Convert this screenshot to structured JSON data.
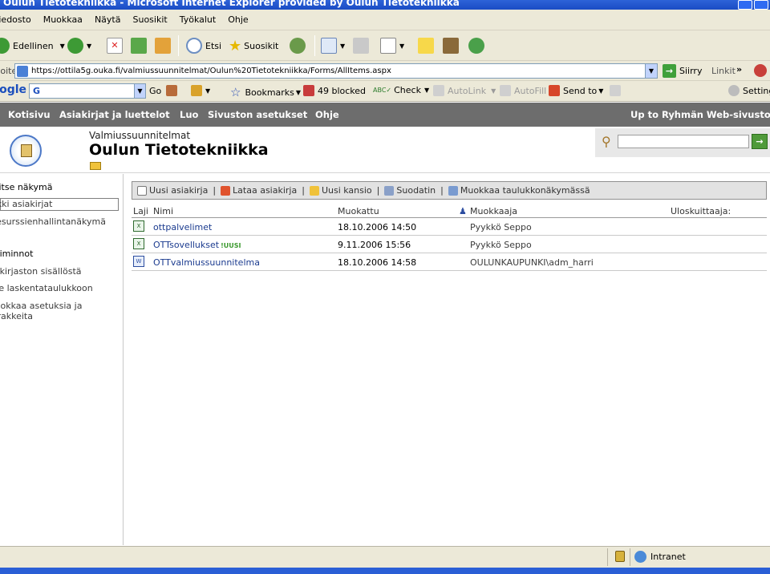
{
  "window": {
    "title": "Oulun Tietotekniikka - Microsoft Internet Explorer provided by Oulun Tietotekniikka"
  },
  "menubar": [
    "Tiedosto",
    "Muokkaa",
    "Näytä",
    "Suosikit",
    "Työkalut",
    "Ohje"
  ],
  "toolbar": {
    "back": "Edellinen",
    "search": "Etsi",
    "favorites": "Suosikit"
  },
  "addressbar": {
    "label": "Osoite",
    "url": "https://ottila5g.ouka.fi/valmiussuunnitelmat/Oulun%20Tietotekniikka/Forms/AllItems.aspx",
    "go": "Siirry",
    "links": "Linkit"
  },
  "google_toolbar": {
    "logo": "Google",
    "search_value": "G",
    "go": "Go",
    "bookmarks": "Bookmarks",
    "blocked": "49 blocked",
    "check": "Check",
    "autolink": "AutoLink",
    "autofill": "AutoFill",
    "sendto": "Send to",
    "settings": "Settings"
  },
  "topnav": {
    "items": [
      "Kotisivu",
      "Asiakirjat ja luettelot",
      "Luo",
      "Sivuston asetukset",
      "Ohje"
    ],
    "right_link": "Up to Ryhmän Web-sivusto"
  },
  "header": {
    "subtitle": "Valmiussuunnitelmat",
    "title": "Oulun Tietotekniikka"
  },
  "leftnav": {
    "select_view_heading": "Valitse näkymä",
    "views": [
      "Kaikki asiakirjat",
      "Resurssienhallintanäkymä"
    ],
    "actions_heading": "Toiminnot",
    "actions": [
      "Hälytys kirjaston sisällöstä"
    ],
    "action2": "Vie laskentataulukkoon",
    "action3_line1": "Muokkaa asetuksia ja",
    "action3_line2": "sarakkeita"
  },
  "commands": [
    "Uusi asiakirja",
    "Lataa asiakirja",
    "Uusi kansio",
    "Suodatin",
    "Muokkaa taulukkonäkymässä"
  ],
  "table": {
    "headers": {
      "type": "Laji",
      "name": "Nimi",
      "modified": "Muokattu",
      "modified_by": "Muokkaaja",
      "checked_out": "Uloskuittaaja:"
    },
    "rows": [
      {
        "name": "ottpalvelimet",
        "modified": "18.10.2006 14:50",
        "modified_by": "Pyykkö Seppo",
        "type": "excel-doc-icon"
      },
      {
        "name": "OTTsovellukset",
        "new_badge": "!UUSI",
        "modified": "9.11.2006 15:56",
        "modified_by": "Pyykkö Seppo",
        "type": "excel-doc-icon"
      },
      {
        "name": "OTTvalmiussuunnitelma",
        "modified": "18.10.2006 14:58",
        "modified_by": "OULUNKAUPUNKI\\adm_harri",
        "type": "word-doc-icon"
      }
    ]
  },
  "statusbar": {
    "zone": "Intranet"
  },
  "colors": {
    "nav_bg": "#6d6d6d",
    "link": "#1b3b8f",
    "new_badge": "#3c9a2f",
    "title_bar": "#1a4cc4"
  }
}
